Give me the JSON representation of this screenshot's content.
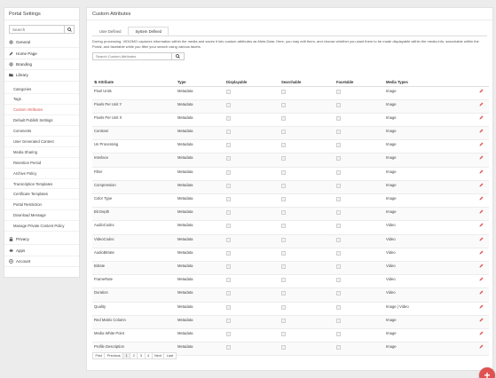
{
  "sidebar": {
    "title": "Portal Settings",
    "search_placeholder": "Search",
    "top_items": [
      {
        "label": "General",
        "icon": "gear-icon"
      },
      {
        "label": "Home Page",
        "icon": "pencil-icon"
      },
      {
        "label": "Branding",
        "icon": "gear-icon"
      },
      {
        "label": "Library",
        "icon": "folder-icon"
      }
    ],
    "library_items": [
      "Categories",
      "Tags",
      "Custom Attributes",
      "Default Publish Settings",
      "Comments",
      "User Generated Content",
      "Media Sharing",
      "Retention Period",
      "Archive Policy",
      "Transcription Templates",
      "Certificate Templates",
      "Portal Restriction",
      "Download Message",
      "Manage Private Content Policy"
    ],
    "active_library_item": "Custom Attributes",
    "bottom_items": [
      {
        "label": "Privacy",
        "icon": "lock-icon"
      },
      {
        "label": "Apps",
        "icon": "apps-icon"
      },
      {
        "label": "Account",
        "icon": "account-icon"
      }
    ]
  },
  "main": {
    "title": "Custom Attributes",
    "tabs": [
      {
        "label": "User Defined",
        "active": false
      },
      {
        "label": "System Defined",
        "active": true
      }
    ],
    "description": "During processing, VIDIZMO captures information within the media and saves it into custom attributes as Meta Data. Here, you may edit them, and choose whether you want them to be made displayable within the media info, searchable within the Portal, and facetable while you filter your search using various facets.",
    "search_placeholder": "Search Custom Attributes",
    "columns": [
      "Attribute",
      "Type",
      "Displayable",
      "Searchable",
      "Facetable",
      "Media Types"
    ],
    "rows": [
      {
        "attribute": "Pixel Units",
        "type": "Metadata",
        "media": "Image"
      },
      {
        "attribute": "Pixels Per Unit Y",
        "type": "Metadata",
        "media": "Image"
      },
      {
        "attribute": "Pixels Per Unit X",
        "type": "Metadata",
        "media": "Image"
      },
      {
        "attribute": "Contrast",
        "type": "Metadata",
        "media": "Image"
      },
      {
        "attribute": "Un Processing",
        "type": "Metadata",
        "media": "Image"
      },
      {
        "attribute": "Interlace",
        "type": "Metadata",
        "media": "Image"
      },
      {
        "attribute": "Filter",
        "type": "Metadata",
        "media": "Image"
      },
      {
        "attribute": "Compression",
        "type": "Metadata",
        "media": "Image"
      },
      {
        "attribute": "Color Type",
        "type": "Metadata",
        "media": "Image"
      },
      {
        "attribute": "Bit Depth",
        "type": "Metadata",
        "media": "Image"
      },
      {
        "attribute": "AudioCodec",
        "type": "Metadata",
        "media": "Video"
      },
      {
        "attribute": "VideoCodec",
        "type": "Metadata",
        "media": "Video"
      },
      {
        "attribute": "AudioBitrate",
        "type": "Metadata",
        "media": "Video"
      },
      {
        "attribute": "Bitrate",
        "type": "Metadata",
        "media": "Video"
      },
      {
        "attribute": "FrameRate",
        "type": "Metadata",
        "media": "Video"
      },
      {
        "attribute": "Duration",
        "type": "Metadata",
        "media": "Video"
      },
      {
        "attribute": "Quality",
        "type": "Metadata",
        "media": "Image | Video"
      },
      {
        "attribute": "Red Matrix Column",
        "type": "Metadata",
        "media": "Image"
      },
      {
        "attribute": "Media White Point",
        "type": "Metadata",
        "media": "Image"
      },
      {
        "attribute": "Profile Description",
        "type": "Metadata",
        "media": "Image"
      }
    ],
    "pagination": [
      "First",
      "Previous",
      "1",
      "2",
      "3",
      "4",
      "Next",
      "Last"
    ],
    "current_page": "1"
  },
  "colors": {
    "accent": "#e05252",
    "active_link": "#d9534f"
  }
}
